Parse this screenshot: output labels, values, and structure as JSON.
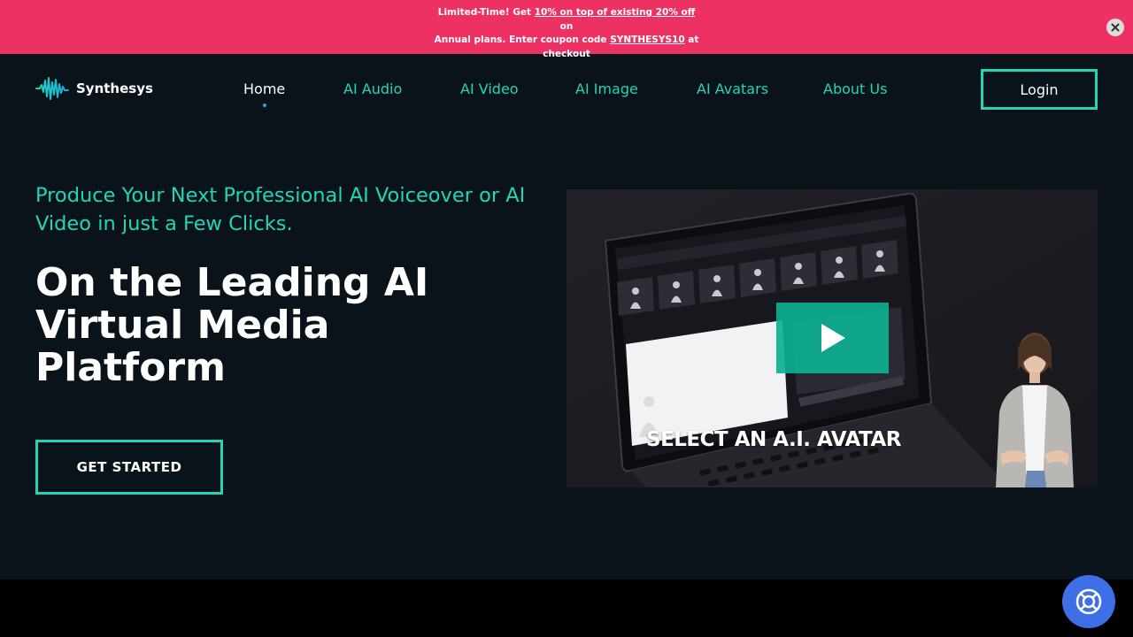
{
  "promo": {
    "line1_prefix": "Limited-Time! Get ",
    "line1_link": "10% on top of existing 20% off",
    "line1_suffix": " on",
    "line2_prefix": "Annual plans. Enter coupon code ",
    "coupon": "SYNTHESYS10",
    "line2_suffix": " at",
    "line3": "checkout",
    "close_icon": "close-icon"
  },
  "header": {
    "brand": "Synthesys",
    "nav": [
      {
        "label": "Home",
        "active": true
      },
      {
        "label": "AI Audio"
      },
      {
        "label": "AI Video"
      },
      {
        "label": "AI Image"
      },
      {
        "label": "AI Avatars"
      },
      {
        "label": "About Us"
      }
    ],
    "login": "Login"
  },
  "hero": {
    "subtitle": "Produce Your Next Professional AI Voiceover or AI Video in just a Few Clicks.",
    "title": "On the Leading AI Virtual Media Platform",
    "cta": "GET STARTED"
  },
  "video": {
    "caption": "SELECT AN A.I. AVATAR",
    "play_icon": "play-icon"
  },
  "help": {
    "icon": "lifebuoy-icon"
  },
  "colors": {
    "accent": "#21d6b8",
    "banner": "#ee3163",
    "background": "#0b131a",
    "help_button": "#3f6fe6"
  }
}
